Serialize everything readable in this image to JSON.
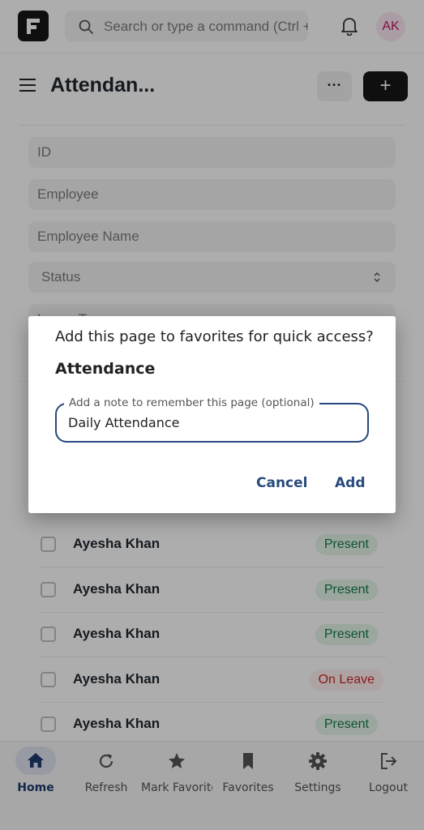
{
  "topbar": {
    "search_placeholder": "Search or type a command (Ctrl + G)",
    "avatar_initials": "AK"
  },
  "page": {
    "title": "Attendan...",
    "more_label": "···",
    "add_label": "+"
  },
  "filters": {
    "id": "ID",
    "employee": "Employee",
    "employee_name": "Employee Name",
    "status": "Status",
    "leave_type": "Leave Type"
  },
  "list": {
    "rows": [
      {
        "name": "Ayesha Khan",
        "status": "Present"
      },
      {
        "name": "Ayesha Khan",
        "status": "Present"
      },
      {
        "name": "Ayesha Khan",
        "status": "Present"
      },
      {
        "name": "Ayesha Khan",
        "status": "On Leave"
      },
      {
        "name": "Ayesha Khan",
        "status": "Present"
      }
    ]
  },
  "dialog": {
    "message": "Add this page to favorites for quick access?",
    "page_name": "Attendance",
    "note_label": "Add a note to remember this page (optional)",
    "note_value": "Daily Attendance",
    "cancel_label": "Cancel",
    "add_label": "Add",
    "accent_color": "#284a7c"
  },
  "bottom_nav": {
    "items": [
      {
        "label": "Home",
        "icon": "home-icon",
        "active": true
      },
      {
        "label": "Refresh",
        "icon": "refresh-icon"
      },
      {
        "label": "Mark Favorites",
        "icon": "star-icon"
      },
      {
        "label": "Favorites",
        "icon": "bookmark-icon"
      },
      {
        "label": "Settings",
        "icon": "gear-icon"
      },
      {
        "label": "Logout",
        "icon": "logout-icon"
      }
    ]
  },
  "colors": {
    "present_bg": "#e4f5e9",
    "present_text": "#16794c",
    "leave_bg": "#fff0f0",
    "leave_text": "#cc2929",
    "nav_active": "#1e3a6e"
  }
}
